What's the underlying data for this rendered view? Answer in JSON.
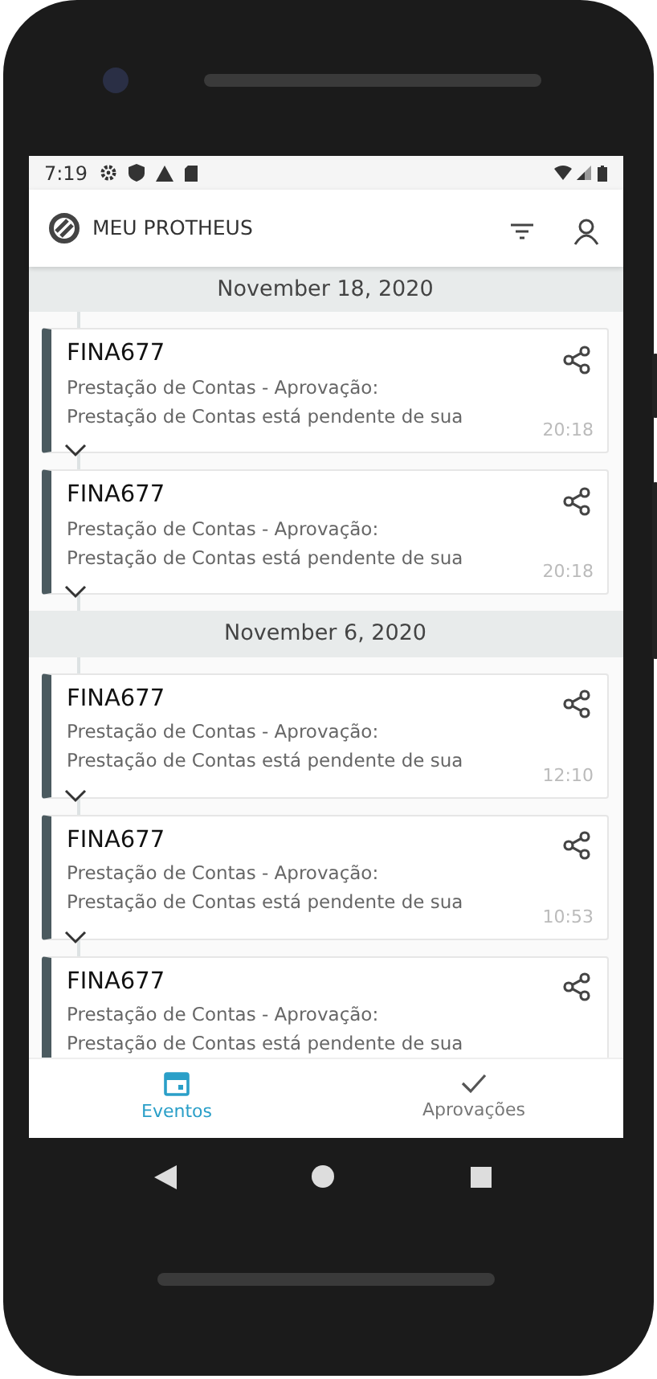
{
  "status_bar": {
    "time": "7:19"
  },
  "app_bar": {
    "title": "MEU PROTHEUS"
  },
  "groups": [
    {
      "date": "November 18, 2020",
      "events": [
        {
          "title": "FINA677",
          "lines": [
            "Prestação de Contas - Aprovação:",
            "Prestação de Contas está pendente de sua"
          ],
          "time": "20:18",
          "expanded": false
        },
        {
          "title": "FINA677",
          "lines": [
            "Prestação de Contas - Aprovação:",
            "Prestação de Contas está pendente de sua"
          ],
          "time": "20:18",
          "expanded": false
        }
      ]
    },
    {
      "date": "November 6, 2020",
      "events": [
        {
          "title": "FINA677",
          "lines": [
            "Prestação de Contas - Aprovação:",
            "Prestação de Contas está pendente de sua"
          ],
          "time": "12:10",
          "expanded": false
        },
        {
          "title": "FINA677",
          "lines": [
            "Prestação de Contas - Aprovação:",
            "Prestação de Contas está pendente de sua"
          ],
          "time": "10:53",
          "expanded": false
        },
        {
          "title": "FINA677",
          "lines": [
            "Prestação de Contas - Aprovação:",
            "Prestação de Contas está pendente de sua"
          ]
        }
      ]
    }
  ],
  "bottom_nav": [
    {
      "kind": "calendar",
      "label": "Eventos",
      "selected": true
    },
    {
      "kind": "check",
      "label": "Aprovações",
      "selected": false
    }
  ]
}
